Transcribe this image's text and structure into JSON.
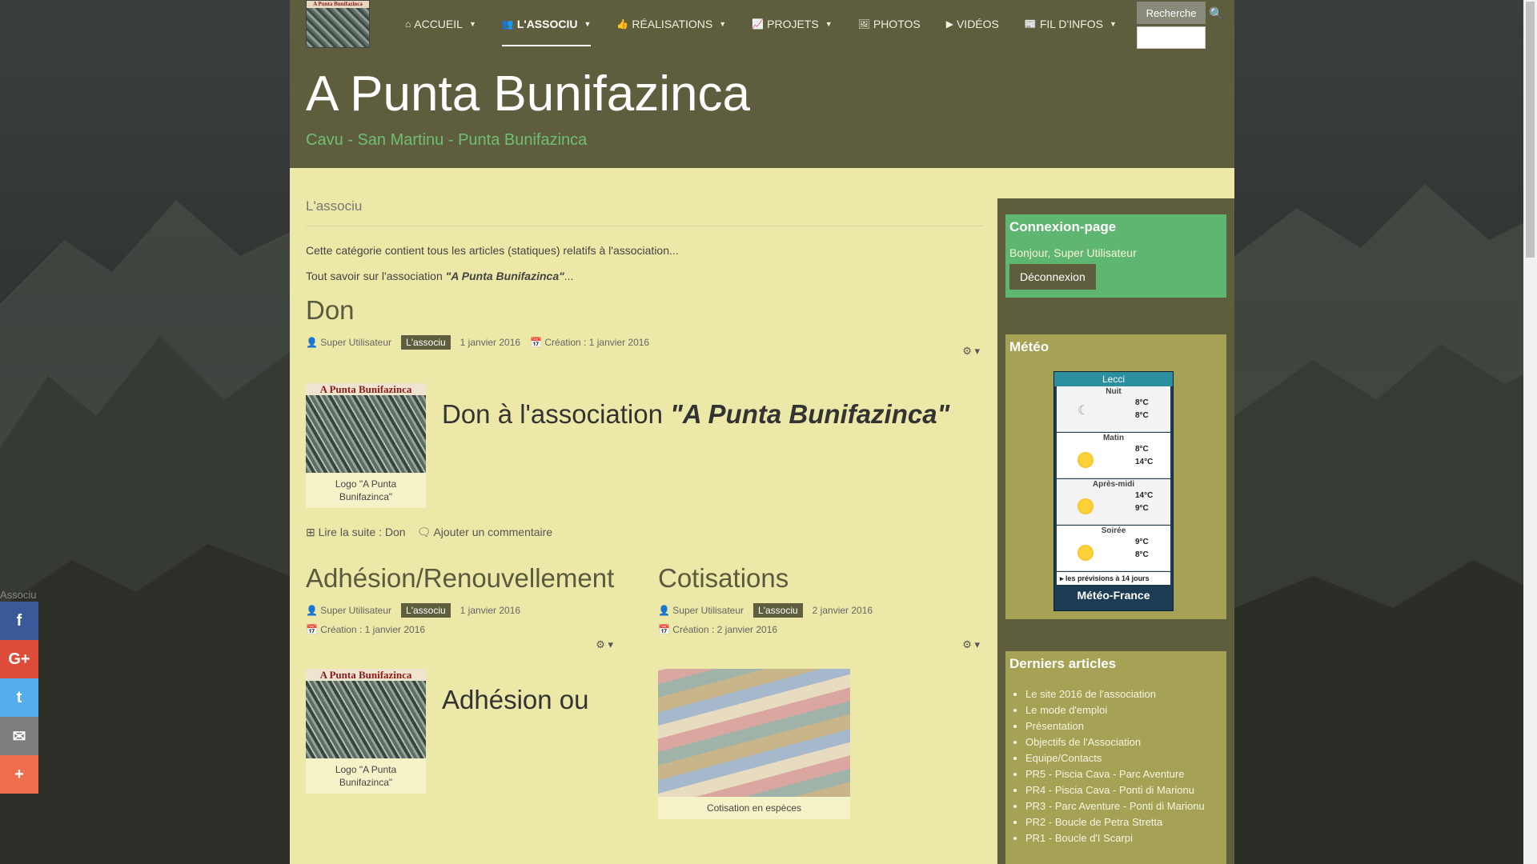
{
  "nav": {
    "items": [
      {
        "icon": "home-icon",
        "glyph": "⌂",
        "label": "ACCUEIL",
        "caret": true,
        "active": false
      },
      {
        "icon": "users-icon",
        "glyph": "👥",
        "label": "L'ASSOCIU",
        "caret": true,
        "active": true
      },
      {
        "icon": "thumbs-up-icon",
        "glyph": "👍",
        "label": "RÉALISATIONS",
        "caret": true,
        "active": false
      },
      {
        "icon": "line-chart-icon",
        "glyph": "📈",
        "label": "PROJETS",
        "caret": true,
        "active": false
      },
      {
        "icon": "photo-icon",
        "glyph": "🖼",
        "label": "PHOTOS",
        "caret": false,
        "active": false
      },
      {
        "icon": "video-icon",
        "glyph": "▶",
        "label": "VIDÉOS",
        "caret": false,
        "active": false
      },
      {
        "icon": "news-icon",
        "glyph": "📰",
        "label": "FIL D'INFOS",
        "caret": true,
        "active": false
      }
    ]
  },
  "search": {
    "label": "Recherche"
  },
  "logo_text": "A Punta  Bunifazinca",
  "site": {
    "title": "A Punta Bunifazinca",
    "tagline": "Cavu - San Martinu - Punta Bunifazinca"
  },
  "category": {
    "breadcrumb": "L'associu",
    "desc1": "Cette catégorie contient tous les articles (statiques) relatifs à l'association...",
    "desc2_prefix": "Tout savoir sur l'association ",
    "desc2_bold": "\"A Punta Bunifazinca\"",
    "desc2_suffix": "..."
  },
  "articles": {
    "don": {
      "title": "Don",
      "author": "Super Utilisateur",
      "category": "L'associu",
      "date": "1 janvier 2016",
      "created": "Création : 1 janvier 2016",
      "heading_prefix": "Don à l'association ",
      "heading_bold": "\"A Punta Bunifazinca\"",
      "caption": "Logo \"A Punta Bunifazinca\"",
      "read_more": "Lire la suite : Don",
      "comment": "Ajouter un commentaire"
    },
    "adhesion": {
      "title": "Adhésion/Renouvellement",
      "author": "Super Utilisateur",
      "category": "L'associu",
      "date": "1 janvier 2016",
      "created": "Création : 1 janvier 2016",
      "heading": "Adhésion ou",
      "caption": "Logo \"A Punta Bunifazinca\""
    },
    "cotisations": {
      "title": "Cotisations",
      "author": "Super Utilisateur",
      "category": "L'associu",
      "date": "2 janvier 2016",
      "created": "Création : 2 janvier 2016",
      "caption": "Cotisation en espèces"
    }
  },
  "sidebar": {
    "login": {
      "title": "Connexion-page",
      "hello": "Bonjour, Super Utilisateur",
      "logout": "Déconnexion"
    },
    "meteo": {
      "title": "Météo",
      "city": "Lecci",
      "rows": [
        {
          "label": "Nuit",
          "symbol": "moon",
          "t1": "8°C",
          "t2": "8°C"
        },
        {
          "label": "Matin",
          "symbol": "sun",
          "t1": "8°C",
          "t2": "14°C"
        },
        {
          "label": "Après-midi",
          "symbol": "sun",
          "t1": "14°C",
          "t2": "9°C"
        },
        {
          "label": "Soirée",
          "symbol": "sun",
          "t1": "9°C",
          "t2": "8°C"
        }
      ],
      "more": "▸ les prévisions à 14 jours",
      "brand": "Météo-France"
    },
    "recent": {
      "title": "Derniers articles",
      "items": [
        "Le site 2016 de l'association",
        "Le mode d'emploi",
        "Présentation",
        "Objectifs de l'Association",
        "Equipe/Contacts",
        "PR5 - Piscia Cava - Parc Aventure",
        "PR4 - Piscia Cava - Ponti di Marionu",
        "PR3 - Parc Aventure - Ponti di Marionu",
        "PR2 - Boucle de Petra Stretta",
        "PR1 - Boucle d'I Scarpi"
      ]
    }
  },
  "social": {
    "title": "Associu",
    "buttons": [
      {
        "name": "facebook",
        "glyph": "f",
        "color": "#3b5998"
      },
      {
        "name": "google-plus",
        "glyph": "G+",
        "color": "#dd4b39"
      },
      {
        "name": "twitter",
        "glyph": "t",
        "color": "#55acee"
      },
      {
        "name": "email",
        "glyph": "✉",
        "color": "#7d7d7d"
      },
      {
        "name": "share-more",
        "glyph": "+",
        "color": "#ee6e4c"
      }
    ]
  },
  "colors": {
    "header": "#5e5e3e",
    "content": "#ece8a8",
    "accent_green": "#5fb670",
    "sidebar_module": "#a5a256"
  }
}
